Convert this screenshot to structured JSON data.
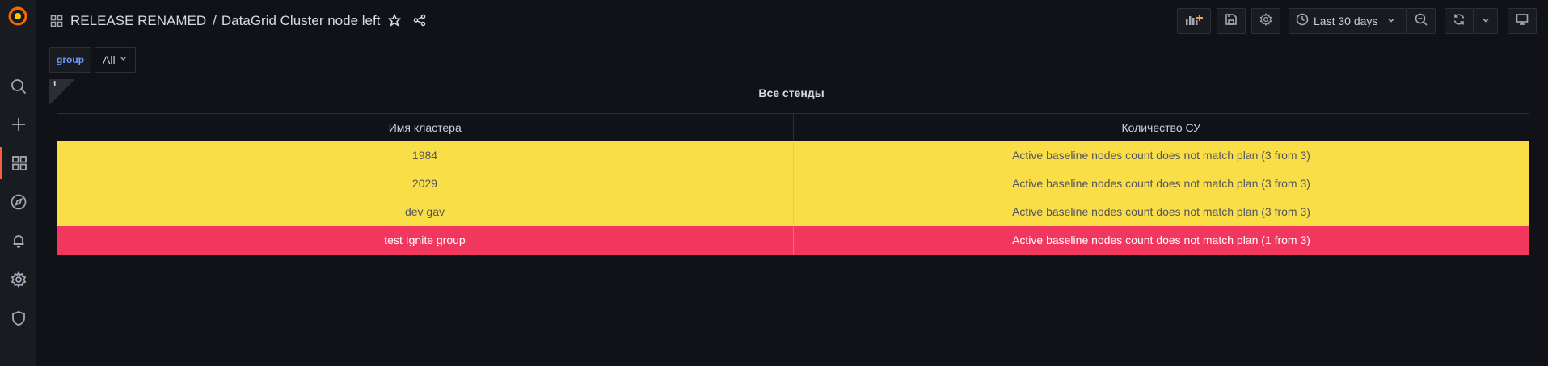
{
  "header": {
    "folder": "RELEASE RENAMED",
    "separator": "/",
    "title": "DataGrid Cluster node left"
  },
  "toolbar": {
    "time_range": "Last 30 days"
  },
  "variables": {
    "group_label": "group",
    "group_value": "All"
  },
  "panel": {
    "info_glyph": "i",
    "title": "Все стенды",
    "columns": [
      "Имя кластера",
      "Количество СУ"
    ],
    "rows": [
      {
        "cluster": "1984",
        "status": "Active baseline nodes count does not match plan (3 from 3)",
        "level": "warning"
      },
      {
        "cluster": "2029",
        "status": "Active baseline nodes count does not match plan (3 from 3)",
        "level": "warning"
      },
      {
        "cluster": "dev gav",
        "status": "Active baseline nodes count does not match plan (3 from 3)",
        "level": "warning"
      },
      {
        "cluster": "test Ignite group",
        "status": "Active baseline nodes count does not match plan (1 from 3)",
        "level": "critical"
      }
    ]
  },
  "colors": {
    "warning": "#fade48",
    "critical": "#f2375e",
    "brand": "#f55f3e"
  }
}
